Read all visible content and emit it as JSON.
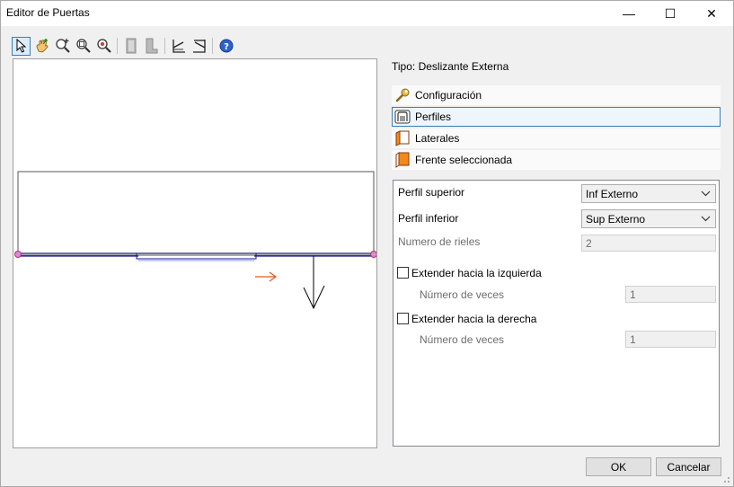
{
  "window": {
    "title": "Editor de Puertas",
    "minimize_glyph": "—",
    "maximize_glyph": "☐",
    "close_glyph": "✕"
  },
  "toolbar": {
    "tools": [
      {
        "name": "select-tool",
        "icon": "pointer-icon",
        "active": true
      },
      {
        "name": "pan-tool",
        "icon": "hand-icon"
      },
      {
        "name": "zoom-in-tool",
        "icon": "zoom-in-icon"
      },
      {
        "name": "zoom-window-tool",
        "icon": "zoom-window-icon"
      },
      {
        "name": "zoom-extents-tool",
        "icon": "zoom-extents-icon"
      },
      {
        "name": "view-front-tool",
        "icon": "door-front-icon"
      },
      {
        "name": "view-side-tool",
        "icon": "door-side-icon"
      },
      {
        "name": "left-open-tool",
        "icon": "opening-left-icon"
      },
      {
        "name": "right-open-tool",
        "icon": "opening-right-icon"
      },
      {
        "name": "help-tool",
        "icon": "help-icon"
      }
    ]
  },
  "tipo": {
    "label": "Tipo: Deslizante Externa"
  },
  "sections": [
    {
      "label": "Configuración",
      "icon": "wrench-icon",
      "selected": false
    },
    {
      "label": "Perfiles",
      "icon": "profiles-icon",
      "selected": true
    },
    {
      "label": "Laterales",
      "icon": "laterals-icon",
      "selected": false
    },
    {
      "label": "Frente seleccionada",
      "icon": "front-icon",
      "selected": false
    }
  ],
  "form": {
    "perfil_superior": {
      "label": "Perfil superior",
      "value": "Inf Externo"
    },
    "perfil_inferior": {
      "label": "Perfil inferior",
      "value": "Sup Externo"
    },
    "numero_rieles": {
      "label": "Numero de rieles",
      "value": "2"
    },
    "extender_izq": {
      "label": "Extender hacia la izquierda",
      "checked": false,
      "veces_label": "Número de veces",
      "veces_value": "1"
    },
    "extender_der": {
      "label": "Extender hacia la derecha",
      "checked": false,
      "veces_label": "Número de veces",
      "veces_value": "1"
    }
  },
  "buttons": {
    "ok": "OK",
    "cancel": "Cancelar"
  },
  "colors": {
    "accent": "#3c7fb1",
    "profile_line": "#1a1a8c",
    "arrow_orange": "#e05a1e"
  }
}
